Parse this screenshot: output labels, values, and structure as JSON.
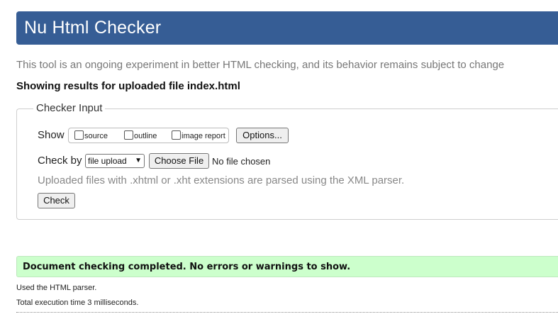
{
  "header": {
    "title": "Nu Html Checker",
    "accent_color": "#365d95"
  },
  "intro_text": "This tool is an ongoing experiment in better HTML checking, and its behavior remains subject to change",
  "results_heading": "Showing results for uploaded file index.html",
  "checker_input": {
    "legend": "Checker Input",
    "show": {
      "label": "Show",
      "options": [
        {
          "label": "source",
          "checked": false
        },
        {
          "label": "outline",
          "checked": false
        },
        {
          "label": "image report",
          "checked": false
        }
      ],
      "options_button": "Options..."
    },
    "check_by": {
      "label": "Check by",
      "selected": "file upload",
      "choose_file_button": "Choose File",
      "file_status": "No file chosen"
    },
    "hint": "Uploaded files with .xhtml or .xht extensions are parsed using the XML parser.",
    "check_button": "Check"
  },
  "result": {
    "message": "Document checking completed. No errors or warnings to show.",
    "color": "#ccffcc"
  },
  "notes": {
    "parser": "Used the HTML parser.",
    "time": "Total execution time 3 milliseconds."
  },
  "icons": {
    "select_chevron": "chevron-down-icon"
  }
}
